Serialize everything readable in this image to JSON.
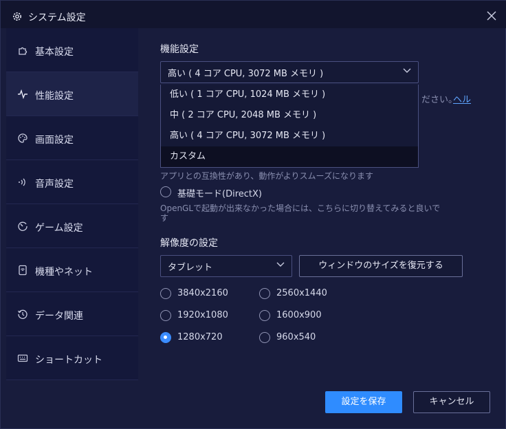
{
  "window": {
    "title": "システム設定"
  },
  "sidebar": {
    "items": [
      {
        "label": "基本設定",
        "icon": "puzzle-icon"
      },
      {
        "label": "性能設定",
        "icon": "pulse-icon"
      },
      {
        "label": "画面設定",
        "icon": "palette-icon"
      },
      {
        "label": "音声設定",
        "icon": "speaker-icon"
      },
      {
        "label": "ゲーム設定",
        "icon": "gauge-icon"
      },
      {
        "label": "機種やネット",
        "icon": "device-icon"
      },
      {
        "label": "データ関連",
        "icon": "history-icon"
      },
      {
        "label": "ショートカット",
        "icon": "keyboard-icon"
      }
    ],
    "active_index": 1
  },
  "performance": {
    "section_title": "機能設定",
    "selected": "高い ( 4 コア CPU, 3072 MB メモリ )",
    "options": [
      "低い ( 1 コア CPU, 1024 MB メモリ )",
      "中 ( 2 コア CPU, 2048 MB メモリ )",
      "高い ( 4 コア CPU, 3072 MB メモリ )",
      "カスタム"
    ],
    "hover_index": 3,
    "hint_tail": "ださい。",
    "help_link": "ヘル"
  },
  "render_mode": {
    "opengl_desc": "アプリとの互換性があり、動作がよりスムーズになります",
    "directx_label": "基礎モード(DirectX)",
    "directx_desc_line1": "OpenGLで起動が出来なかった場合には、こちらに切り替えてみると良いで",
    "directx_desc_line2": "す"
  },
  "resolution": {
    "section_title": "解像度の設定",
    "device_select": "タブレット",
    "restore_button": "ウィンドウのサイズを復元する",
    "options": [
      {
        "label": "3840x2160",
        "checked": false
      },
      {
        "label": "2560x1440",
        "checked": false
      },
      {
        "label": "1920x1080",
        "checked": false
      },
      {
        "label": "1600x900",
        "checked": false
      },
      {
        "label": "1280x720",
        "checked": true
      },
      {
        "label": "960x540",
        "checked": false
      }
    ]
  },
  "footer": {
    "save_label": "設定を保存",
    "cancel_label": "キャンセル"
  },
  "colors": {
    "accent": "#2f8cff",
    "background": "#181c3c",
    "sidebar_bg": "#14183a",
    "link": "#5fa5ff"
  }
}
